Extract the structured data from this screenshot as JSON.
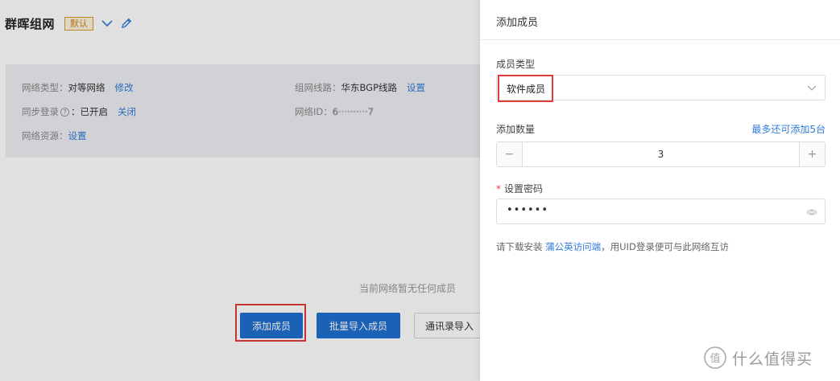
{
  "header": {
    "title": "群晖组网",
    "badge": "默认"
  },
  "info": {
    "network_type_label": "网络类型：",
    "network_type_value": "对等网络",
    "network_type_action": "修改",
    "line_label": "组网线路：",
    "line_value": "华东BGP线路",
    "line_action": "设置",
    "sync_label": "同步登录",
    "sync_value": "：已开启",
    "sync_action": "关闭",
    "network_id_label": "网络ID：",
    "network_id_value": "6··········7",
    "resource_label": "网络资源：",
    "resource_action": "设置"
  },
  "main": {
    "empty_text": "当前网络暂无任何成员",
    "add_member_button": "添加成员",
    "batch_import_button": "批量导入成员",
    "contacts_import_button": "通讯录导入"
  },
  "drawer": {
    "title": "添加成员",
    "member_type_label": "成员类型",
    "member_type_value": "软件成员",
    "count_label": "添加数量",
    "count_hint": "最多还可添加5台",
    "count_value": "3",
    "password_label": "设置密码",
    "password_value": "••••••",
    "tip_prefix": "请下载安装 ",
    "tip_link": "蒲公英访问端",
    "tip_suffix": "，用UID登录便可与此网络互访"
  },
  "watermark": {
    "text": "什么值得买",
    "logo_char": "值"
  },
  "colors": {
    "primary": "#1f6fce",
    "link": "#2f7bd8",
    "highlight": "#e23b3b",
    "badge_border": "#d89a2b"
  }
}
